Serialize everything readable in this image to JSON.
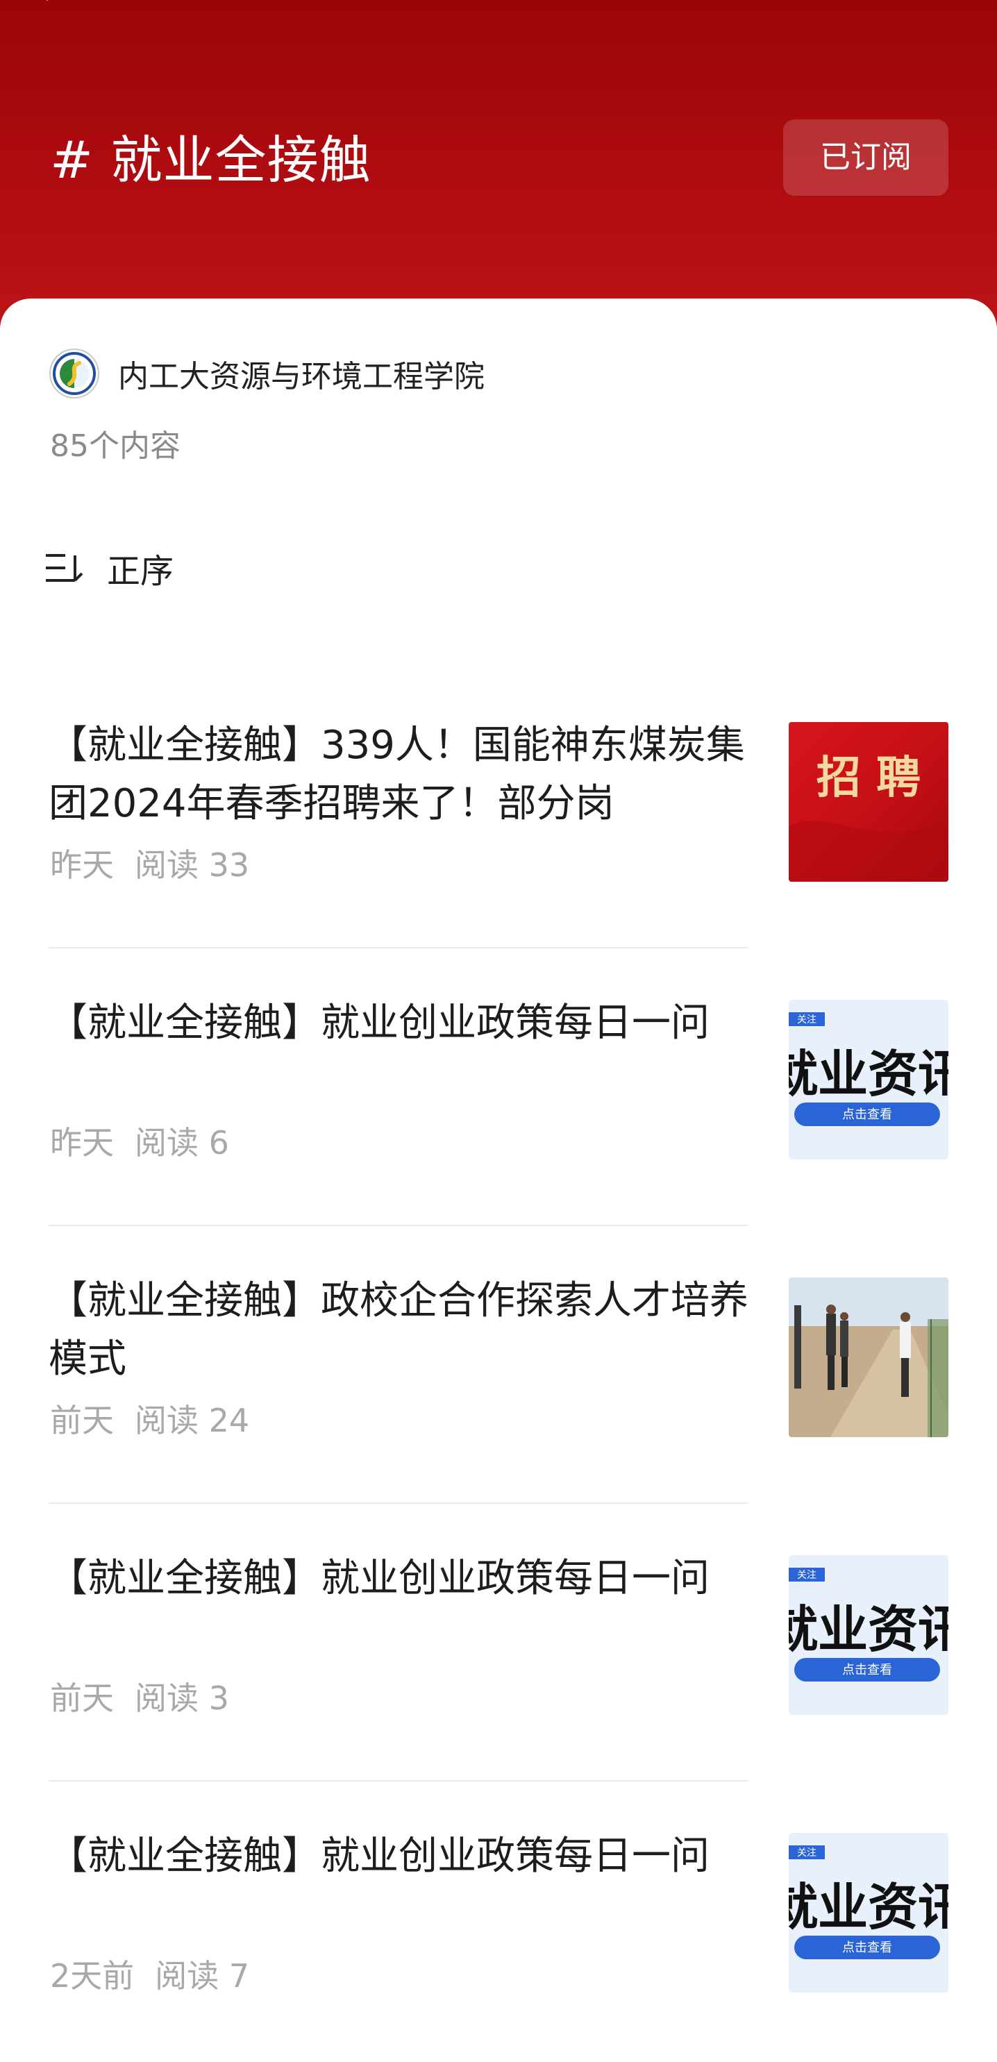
{
  "header": {
    "title": "# 就业全接触",
    "subscribe_label": "已订阅",
    "close_icon": "close-icon"
  },
  "account": {
    "name": "内工大资源与环境工程学院",
    "content_count": "85个内容",
    "logo_icon": "school-logo"
  },
  "sort": {
    "label": "正序",
    "icon": "sort-icon"
  },
  "articles": [
    {
      "title": "【就业全接触】339人！国能神东煤炭集团2024年春季招聘来了！部分岗",
      "date": "昨天",
      "reads": "阅读 33",
      "thumb": "recruit",
      "thumb_text": "招 聘"
    },
    {
      "title": "【就业全接触】就业创业政策每日一问",
      "date": "昨天",
      "reads": "阅读 6",
      "thumb": "news",
      "thumb_text": "就业资讯",
      "thumb_tag": "关注",
      "thumb_button": "点击查看"
    },
    {
      "title": "【就业全接触】政校企合作探索人才培养模式",
      "date": "前天",
      "reads": "阅读 24",
      "thumb": "photo"
    },
    {
      "title": "【就业全接触】就业创业政策每日一问",
      "date": "前天",
      "reads": "阅读 3",
      "thumb": "news",
      "thumb_text": "就业资讯",
      "thumb_tag": "关注",
      "thumb_button": "点击查看"
    },
    {
      "title": "【就业全接触】就业创业政策每日一问",
      "date": "2天前",
      "reads": "阅读 7",
      "thumb": "news",
      "thumb_text": "就业资讯",
      "thumb_tag": "关注",
      "thumb_button": "点击查看"
    }
  ],
  "colors": {
    "header_red": "#b20d12",
    "text_primary": "#1d1d1d",
    "text_secondary": "#a8a8a8",
    "accent_blue": "#2a64d6"
  }
}
